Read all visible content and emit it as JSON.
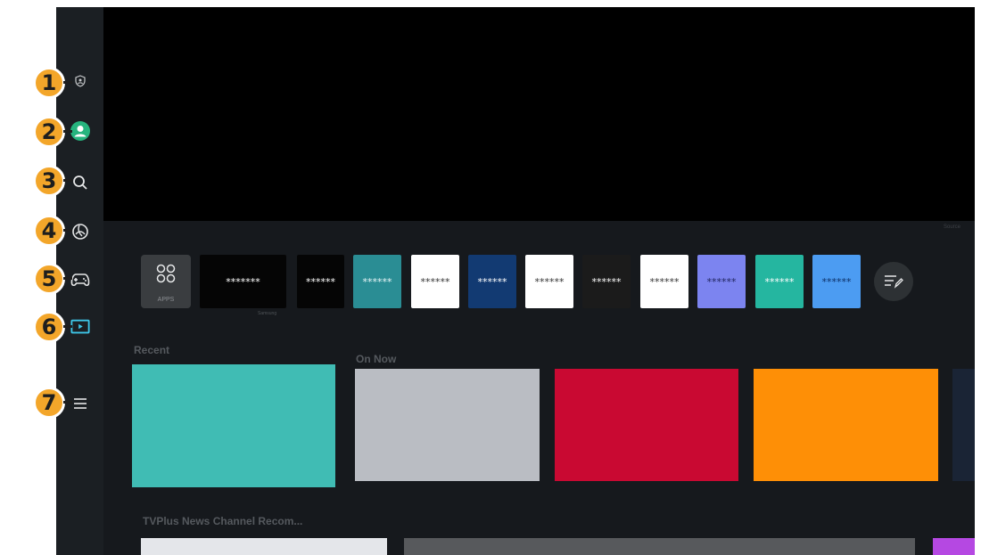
{
  "sidebar": {
    "items": [
      {
        "icon": "shield-user-icon",
        "badge": "1"
      },
      {
        "icon": "profile-icon",
        "badge": "2"
      },
      {
        "icon": "search-icon",
        "badge": "3"
      },
      {
        "icon": "ambient-icon",
        "badge": "4"
      },
      {
        "icon": "game-controller-icon",
        "badge": "5"
      },
      {
        "icon": "media-icon",
        "badge": "6"
      },
      {
        "icon": "menu-icon",
        "badge": "7"
      }
    ],
    "profile_color": "#26b47e",
    "active_color": "#3ec6e8"
  },
  "top_right_label": "Source",
  "apps_tile": {
    "label": "APPS"
  },
  "app_tiles": [
    {
      "text": "*******",
      "bg": "#050505",
      "fg": "#ffffff",
      "caption": "Samsung"
    },
    {
      "text": "******",
      "bg": "#050505",
      "fg": "#ffffff"
    },
    {
      "text": "******",
      "bg": "#2a8d94",
      "fg": "#e8f6f7"
    },
    {
      "text": "******",
      "bg": "#ffffff",
      "fg": "#333333"
    },
    {
      "text": "******",
      "bg": "#123a72",
      "fg": "#ffffff"
    },
    {
      "text": "******",
      "bg": "#ffffff",
      "fg": "#333333"
    },
    {
      "text": "******",
      "bg": "#1b1b1b",
      "fg": "#ffffff"
    },
    {
      "text": "******",
      "bg": "#ffffff",
      "fg": "#333333"
    },
    {
      "text": "******",
      "bg": "#7c84f0",
      "fg": "#1f245e"
    },
    {
      "text": "******",
      "bg": "#25b6a0",
      "fg": "#ffffff"
    },
    {
      "text": "******",
      "bg": "#4c9cf2",
      "fg": "#0d2f66"
    }
  ],
  "sections": {
    "recent": "Recent",
    "on_now": "On Now",
    "news": "TVPlus News Channel Recom..."
  },
  "cards": {
    "recent": {
      "color": "#40bcb4"
    },
    "on_now": [
      {
        "color": "#babdc3"
      },
      {
        "color": "#c90932"
      },
      {
        "color": "#fe8f06"
      },
      {
        "color": "#1a2435"
      }
    ],
    "news": [
      {
        "color": "#e4e6ea"
      },
      {
        "color": "#57595c"
      },
      {
        "color": "#b548e2"
      }
    ]
  }
}
